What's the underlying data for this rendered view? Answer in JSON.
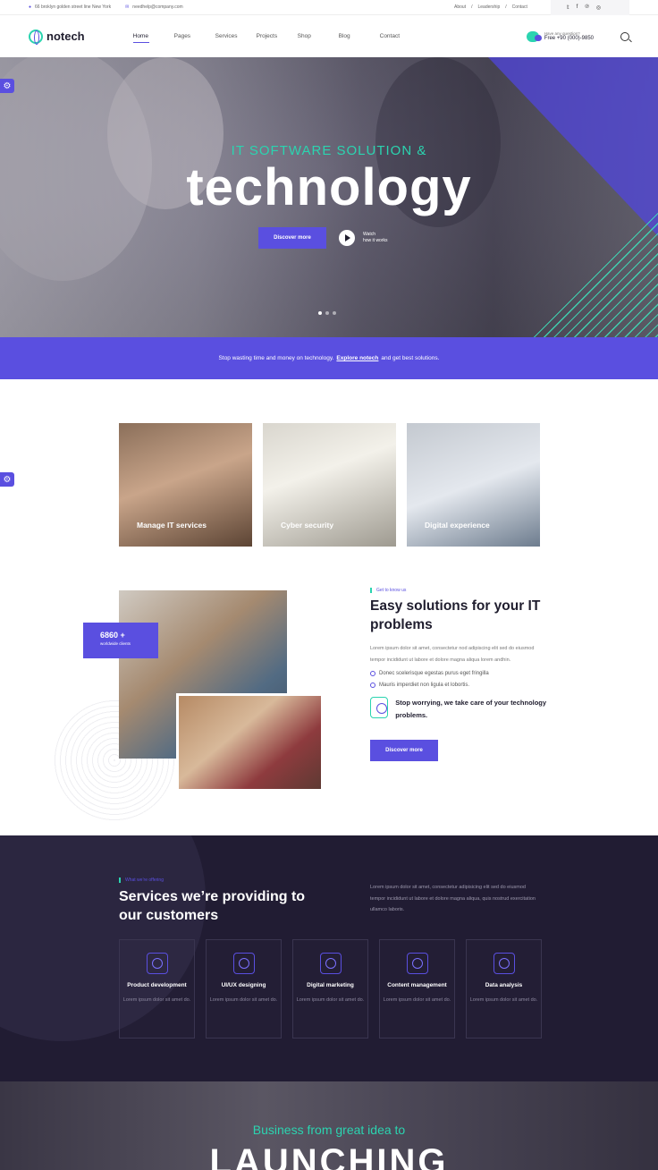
{
  "topbar": {
    "address": "66 broklyn golden street line New York",
    "email": "needhelp@company.com",
    "links": [
      "About",
      "Leadership",
      "Contact"
    ]
  },
  "header": {
    "logo": "notech",
    "nav": [
      "Home",
      "Pages",
      "Services",
      "Projects",
      "Shop",
      "Blog",
      "Contact"
    ],
    "help_question": "Have any question?",
    "help_phone": "Free +90 (000)-9850"
  },
  "hero": {
    "pretitle": "IT SOFTWARE SOLUTION &",
    "title": "technology",
    "button": "Discover more",
    "watch_line1": "Watch",
    "watch_line2": "how it works"
  },
  "band": {
    "text_before": "Stop wasting time and money on technology.",
    "link": "Explore notech",
    "text_after": "and get best solutions."
  },
  "cards": [
    "Manage IT services",
    "Cyber security",
    "Digital experience"
  ],
  "about": {
    "stat_number": "6860 +",
    "stat_label": "worldwide clients",
    "eyebrow": "Get to know us",
    "heading": "Easy solutions for your IT problems",
    "paragraph": "Lorem ipsum dolor sit amet, consectetur nod adipiscing elit sed do eiusmod tempor incididunt ut labore et dolore magna aliqua lorem andhin.",
    "bullets": [
      "Donec scelerisque egestas purus eget fringilla",
      "Mauris imperdiet non ligula et lobortis."
    ],
    "callout": "Stop worrying, we take care of your technology problems.",
    "button": "Discover more"
  },
  "services": {
    "eyebrow": "What we’re offering",
    "heading": "Services we’re providing to our customers",
    "intro": "Lorem ipsum dolor sit amet, consectetur adipisicing elit sed do eiusmod tempor incididunt ut labore et dolore magna aliqua, quis nostrud exercitation ullamco laboris.",
    "items": [
      {
        "name": "Product development",
        "desc": "Lorem ipsum dolor sit amet do."
      },
      {
        "name": "UI/UX designing",
        "desc": "Lorem ipsum dolor sit amet do."
      },
      {
        "name": "Digital marketing",
        "desc": "Lorem ipsum dolor sit amet do."
      },
      {
        "name": "Content management",
        "desc": "Lorem ipsum dolor sit amet do."
      },
      {
        "name": "Data analysis",
        "desc": "Lorem ipsum dolor sit amet do."
      }
    ]
  },
  "bottom": {
    "pretitle": "Business from great idea to",
    "title": "LAUNCHING"
  },
  "colors": {
    "accent": "#5a4fe0",
    "teal": "#2bd4b0",
    "dark": "#211c33"
  }
}
